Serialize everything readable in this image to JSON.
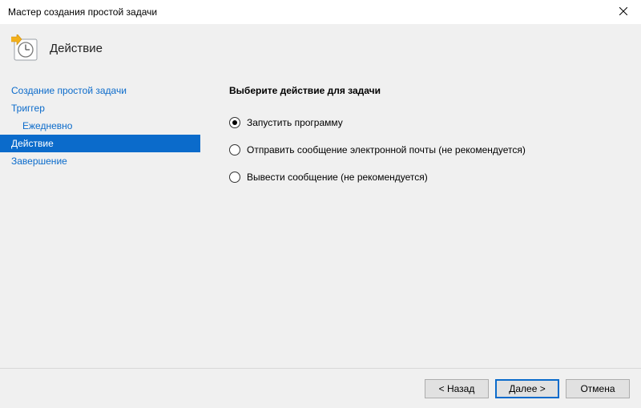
{
  "window": {
    "title": "Мастер создания простой задачи"
  },
  "header": {
    "title": "Действие"
  },
  "sidebar": {
    "items": [
      {
        "label": "Создание простой задачи",
        "indent": false,
        "active": false
      },
      {
        "label": "Триггер",
        "indent": false,
        "active": false
      },
      {
        "label": "Ежедневно",
        "indent": true,
        "active": false
      },
      {
        "label": "Действие",
        "indent": false,
        "active": true
      },
      {
        "label": "Завершение",
        "indent": false,
        "active": false
      }
    ]
  },
  "main": {
    "heading": "Выберите действие для задачи",
    "options": [
      {
        "label": "Запустить программу",
        "checked": true
      },
      {
        "label": "Отправить сообщение электронной почты (не рекомендуется)",
        "checked": false
      },
      {
        "label": "Вывести сообщение (не рекомендуется)",
        "checked": false
      }
    ]
  },
  "footer": {
    "back": "< Назад",
    "next": "Далее >",
    "cancel": "Отмена"
  }
}
